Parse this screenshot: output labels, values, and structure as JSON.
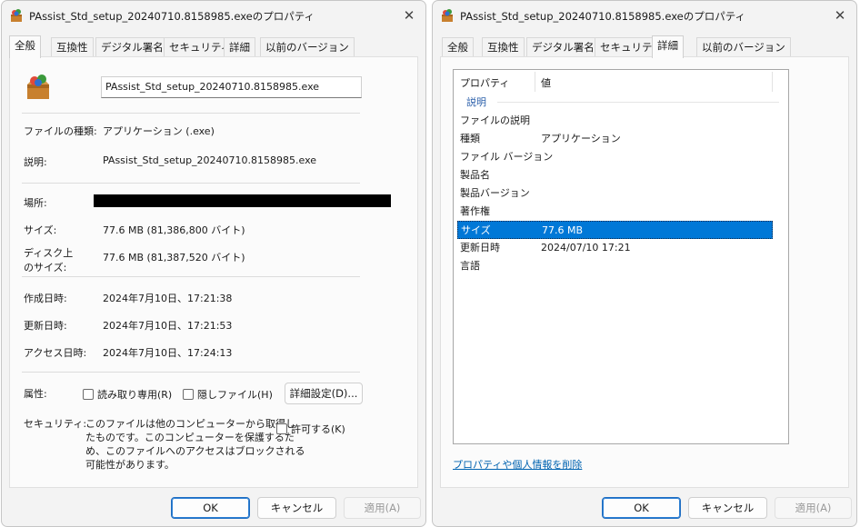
{
  "left": {
    "title": "PAssist_Std_setup_20240710.8158985.exeのプロパティ",
    "tabs": [
      "全般",
      "互換性",
      "デジタル署名",
      "セキュリティ",
      "詳細",
      "以前のバージョン"
    ],
    "filename": "PAssist_Std_setup_20240710.8158985.exe",
    "fields": {
      "type_label": "ファイルの種類:",
      "type_value": "アプリケーション (.exe)",
      "desc_label": "説明:",
      "desc_value": "PAssist_Std_setup_20240710.8158985.exe",
      "location_label": "場所:",
      "size_label": "サイズ:",
      "size_value": "77.6 MB (81,386,800 バイト)",
      "disk_label_1": "ディスク上",
      "disk_label_2": "のサイズ:",
      "disk_value": "77.6 MB (81,387,520 バイト)",
      "created_label": "作成日時:",
      "created_value": "2024年7月10日、17:21:38",
      "modified_label": "更新日時:",
      "modified_value": "2024年7月10日、17:21:53",
      "accessed_label": "アクセス日時:",
      "accessed_value": "2024年7月10日、17:24:13",
      "attr_label": "属性:",
      "readonly_label": "読み取り専用(R)",
      "hidden_label": "隠しファイル(H)",
      "advanced_label": "詳細設定(D)...",
      "security_label": "セキュリティ:",
      "security_text_1": "このファイルは他のコンピューターから取得し",
      "security_text_2": "たものです。このコンピューターを保護するた",
      "security_text_3": "め、このファイルへのアクセスはブロックされる",
      "security_text_4": "可能性があります。",
      "allow_label": "許可する(K)"
    },
    "buttons": {
      "ok": "OK",
      "cancel": "キャンセル",
      "apply": "適用(A)"
    }
  },
  "right": {
    "title": "PAssist_Std_setup_20240710.8158985.exeのプロパティ",
    "tabs": [
      "全般",
      "互換性",
      "デジタル署名",
      "セキュリティ",
      "詳細",
      "以前のバージョン"
    ],
    "columns": [
      "プロパティ",
      "値"
    ],
    "group": "説明",
    "rows": [
      {
        "k": "ファイルの説明",
        "v": ""
      },
      {
        "k": "種類",
        "v": "アプリケーション"
      },
      {
        "k": "ファイル バージョン",
        "v": ""
      },
      {
        "k": "製品名",
        "v": ""
      },
      {
        "k": "製品バージョン",
        "v": ""
      },
      {
        "k": "著作権",
        "v": ""
      },
      {
        "k": "サイズ",
        "v": "77.6 MB"
      },
      {
        "k": "更新日時",
        "v": "2024/07/10 17:21"
      },
      {
        "k": "言語",
        "v": ""
      }
    ],
    "remove_link": "プロパティや個人情報を削除",
    "buttons": {
      "ok": "OK",
      "cancel": "キャンセル",
      "apply": "適用(A)"
    }
  }
}
